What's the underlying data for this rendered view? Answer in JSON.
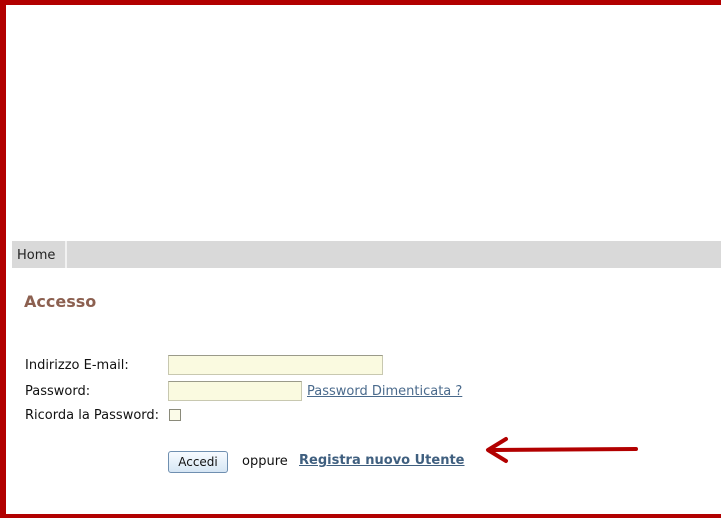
{
  "nav": {
    "home_label": "Home"
  },
  "page": {
    "title": "Accesso"
  },
  "form": {
    "email_label": "Indirizzo E-mail:",
    "email_value": "",
    "password_label": "Password:",
    "password_value": "",
    "forgot_password_link": "Password Dimenticata ?",
    "remember_label": "Ricorda la Password:",
    "remember_checked": false,
    "submit_label": "Accedi",
    "or_text": "oppure",
    "register_link": "Registra nuovo Utente"
  },
  "annotation": {
    "arrow_color": "#b20000"
  },
  "colors": {
    "frame_border": "#b20000",
    "nav_background": "#d9d9d9",
    "title_color": "#8c6050",
    "input_background": "#fafae0",
    "link_color": "#4a6a8c"
  }
}
